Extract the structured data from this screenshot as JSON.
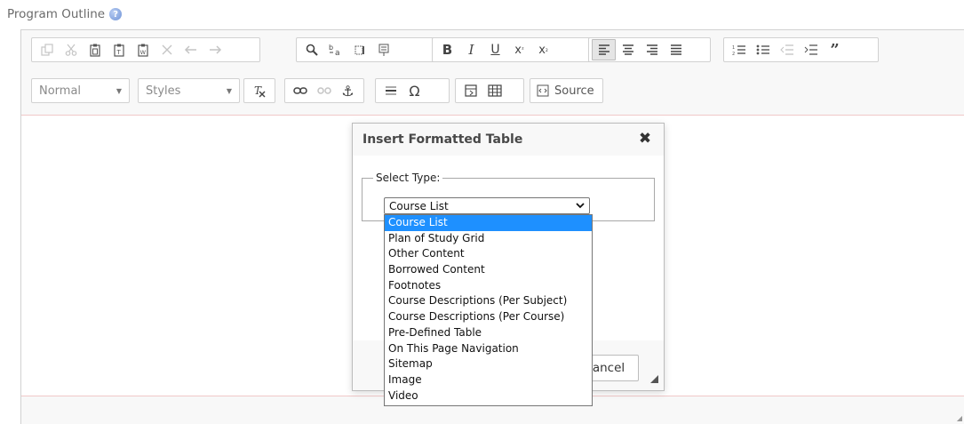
{
  "field": {
    "label": "Program Outline",
    "help_icon": "help-question-icon"
  },
  "toolbar": {
    "row1": [
      {
        "name": "copy-icon",
        "glyph": "⎘",
        "disabled": true
      },
      {
        "name": "cut-icon",
        "glyph": "✂",
        "disabled": true
      },
      {
        "name": "paste-icon",
        "glyph": "📋",
        "disabled": false
      },
      {
        "name": "paste-text-icon",
        "glyph": "📋",
        "disabled": false
      },
      {
        "name": "paste-word-icon",
        "glyph": "📋",
        "disabled": false
      },
      {
        "name": "remove-format-icon",
        "glyph": "✕",
        "disabled": true
      },
      {
        "name": "undo-icon",
        "glyph": "↶",
        "disabled": true
      },
      {
        "name": "redo-icon",
        "glyph": "↷",
        "disabled": true
      },
      {
        "name": "find-icon",
        "glyph": "🔍",
        "disabled": false
      },
      {
        "name": "replace-icon",
        "glyph": "ᵇa",
        "disabled": false
      },
      {
        "name": "select-all-icon",
        "glyph": "▯",
        "disabled": false
      },
      {
        "name": "spellcheck-icon",
        "glyph": "¶",
        "disabled": false
      },
      {
        "name": "bold-icon",
        "glyph": "B",
        "disabled": false
      },
      {
        "name": "italic-icon",
        "glyph": "I",
        "disabled": false
      },
      {
        "name": "underline-icon",
        "glyph": "U",
        "disabled": false
      },
      {
        "name": "superscript-icon",
        "glyph": "x²",
        "disabled": false
      },
      {
        "name": "subscript-icon",
        "glyph": "x₂",
        "disabled": false
      },
      {
        "name": "align-left-icon",
        "glyph": "≡",
        "disabled": false,
        "active": true
      },
      {
        "name": "align-center-icon",
        "glyph": "≡",
        "disabled": false
      },
      {
        "name": "align-right-icon",
        "glyph": "≡",
        "disabled": false
      },
      {
        "name": "align-justify-icon",
        "glyph": "≡",
        "disabled": false
      },
      {
        "name": "numbered-list-icon",
        "glyph": "⒈",
        "disabled": false
      },
      {
        "name": "bulleted-list-icon",
        "glyph": "•",
        "disabled": false
      },
      {
        "name": "outdent-icon",
        "glyph": "⇤",
        "disabled": true
      },
      {
        "name": "indent-icon",
        "glyph": "⇥",
        "disabled": false
      },
      {
        "name": "blockquote-icon",
        "glyph": "❞",
        "disabled": false
      }
    ],
    "format_combo": "Normal",
    "styles_combo": "Styles",
    "source_label": "Source"
  },
  "dialog": {
    "title": "Insert Formatted Table",
    "legend": "Select Type:",
    "selected_value": "Course List",
    "options": [
      "Course List",
      "Plan of Study Grid",
      "Other Content",
      "Borrowed Content",
      "Footnotes",
      "Course Descriptions (Per Subject)",
      "Course Descriptions (Per Course)",
      "Pre-Defined Table",
      "On This Page Navigation",
      "Sitemap",
      "Image",
      "Video"
    ],
    "cancel_visible_text": "ancel",
    "close_glyph": "✖"
  },
  "colors": {
    "selection": "#1e90ff",
    "editor_border": "#f0c8c8",
    "toolbar_bg": "#f8f8f8"
  }
}
